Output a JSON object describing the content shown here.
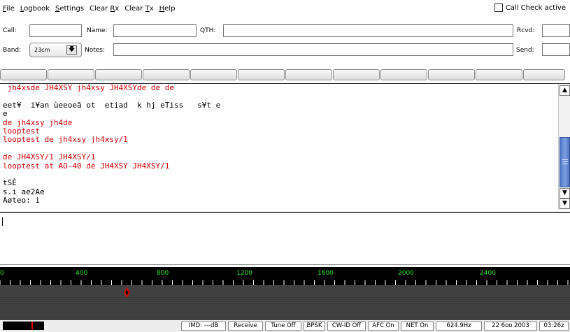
{
  "menu": [
    "File",
    "Logbook",
    "Settings",
    "Clear Rx",
    "Clear Tx",
    "Help"
  ],
  "call_check_label": "Call Check active",
  "fields": {
    "call": {
      "label": "Call:",
      "value": ""
    },
    "name": {
      "label": "Name:",
      "value": ""
    },
    "qth": {
      "label": "QTH:",
      "value": ""
    },
    "rcvd": {
      "label": "Rcvd:",
      "value": ""
    },
    "band": {
      "label": "Band:",
      "value": "23cm"
    },
    "notes": {
      "label": "Notes:",
      "value": ""
    },
    "send": {
      "label": "Send:",
      "value": ""
    }
  },
  "rx_lines": [
    {
      "text": " jh4xsde JH4XSY jh4xsy JH4XSYde de de",
      "color": "red"
    },
    {
      "text": "",
      "color": "black"
    },
    {
      "text": "eet¥  i¥an ùeeoeã ot  etiad  k hj eTiss   s¥t e",
      "color": "black"
    },
    {
      "text": "e",
      "color": "black"
    },
    {
      "text": "de jh4xsy jh4de",
      "color": "red"
    },
    {
      "text": "looptest",
      "color": "red"
    },
    {
      "text": "looptest de jh4xsy jh4xsy/1",
      "color": "red"
    },
    {
      "text": "",
      "color": "black"
    },
    {
      "text": "de JH4XSY/1 JH4XSY/1",
      "color": "red"
    },
    {
      "text": "looptest at AO-40 de JH4XSY JH4XSY/1",
      "color": "red"
    },
    {
      "text": "",
      "color": "black"
    },
    {
      "text": "tSÈ",
      "color": "black"
    },
    {
      "text": "s.i ae2Ae",
      "color": "black"
    },
    {
      "text": "Aøteo: i",
      "color": "black"
    }
  ],
  "scale_labels": [
    "0",
    "400",
    "800",
    "1200",
    "1600",
    "2000",
    "2400"
  ],
  "status": {
    "imd": "IMD: ---dB",
    "mode_rx": "Receive",
    "tune": "Tune Off",
    "modem": "BPSK",
    "cwid": "CW-ID Off",
    "afc": "AFC On",
    "net": "NET On",
    "freq": "624.9Hz",
    "date": "22 6oo 2003",
    "time": "03:26z"
  },
  "colors": {
    "rx_red": "#d10000",
    "scale_green": "#2ee62e",
    "marker_red": "#e00000"
  }
}
